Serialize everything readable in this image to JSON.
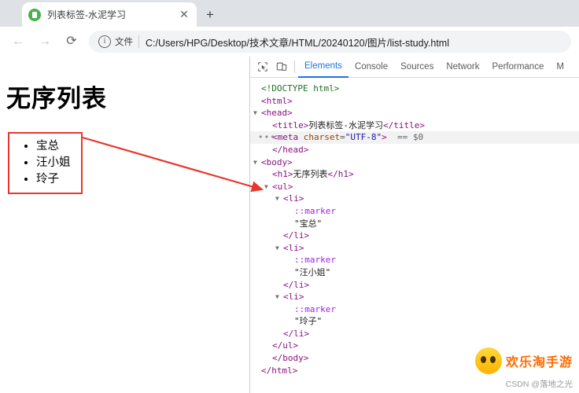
{
  "browser": {
    "tab": {
      "title": "列表标签-水泥学习",
      "favicon": "page-icon",
      "close": "✕"
    },
    "new_tab_label": "+",
    "nav": {
      "back": "←",
      "forward": "→",
      "reload": "⟳"
    },
    "omnibox": {
      "info_icon": "i",
      "scheme_label": "文件",
      "url": "C:/Users/HPG/Desktop/技术文章/HTML/20240120/图片/list-study.html"
    }
  },
  "page": {
    "heading": "无序列表",
    "list_items": [
      "宝总",
      "汪小姐",
      "玲子"
    ]
  },
  "devtools": {
    "toolbar": {
      "inspect_icon": "inspect-element-icon",
      "device_icon": "device-toolbar-icon"
    },
    "tabs": [
      {
        "label": "Elements",
        "active": true
      },
      {
        "label": "Console",
        "active": false
      },
      {
        "label": "Sources",
        "active": false
      },
      {
        "label": "Network",
        "active": false
      },
      {
        "label": "Performance",
        "active": false
      },
      {
        "label": "M",
        "active": false
      }
    ],
    "dom": [
      {
        "indent": 0,
        "arrow": "",
        "dots": false,
        "highlight": false,
        "parts": [
          {
            "c": "cm",
            "t": "<!DOCTYPE html>"
          }
        ]
      },
      {
        "indent": 0,
        "arrow": "",
        "dots": false,
        "highlight": false,
        "parts": [
          {
            "c": "tw",
            "t": "<html>"
          }
        ]
      },
      {
        "indent": 0,
        "arrow": "▼",
        "dots": false,
        "highlight": false,
        "parts": [
          {
            "c": "tw",
            "t": "<head>"
          }
        ]
      },
      {
        "indent": 1,
        "arrow": "",
        "dots": false,
        "highlight": false,
        "parts": [
          {
            "c": "tw",
            "t": "<title>"
          },
          {
            "c": "tx",
            "t": "列表标签-水泥学习"
          },
          {
            "c": "tw",
            "t": "</title>"
          }
        ]
      },
      {
        "indent": 1,
        "arrow": "",
        "dots": true,
        "highlight": true,
        "parts": [
          {
            "c": "tw",
            "t": "<meta "
          },
          {
            "c": "at",
            "t": "charset"
          },
          {
            "c": "eq",
            "t": "="
          },
          {
            "c": "av",
            "t": "\"UTF-8\""
          },
          {
            "c": "tw",
            "t": ">"
          },
          {
            "c": "sel",
            "t": "  == $0"
          }
        ]
      },
      {
        "indent": 1,
        "arrow": "",
        "dots": false,
        "highlight": false,
        "parts": [
          {
            "c": "tw",
            "t": "</head>"
          }
        ]
      },
      {
        "indent": 0,
        "arrow": "▼",
        "dots": false,
        "highlight": false,
        "parts": [
          {
            "c": "tw",
            "t": "<body>"
          }
        ]
      },
      {
        "indent": 1,
        "arrow": "",
        "dots": false,
        "highlight": false,
        "parts": [
          {
            "c": "tw",
            "t": "<h1>"
          },
          {
            "c": "tx",
            "t": "无序列表"
          },
          {
            "c": "tw",
            "t": "</h1>"
          }
        ]
      },
      {
        "indent": 1,
        "arrow": "▼",
        "dots": false,
        "highlight": false,
        "parts": [
          {
            "c": "tw",
            "t": "<ul>"
          }
        ]
      },
      {
        "indent": 2,
        "arrow": "▼",
        "dots": false,
        "highlight": false,
        "parts": [
          {
            "c": "tw",
            "t": "<li>"
          }
        ]
      },
      {
        "indent": 3,
        "arrow": "",
        "dots": false,
        "highlight": false,
        "parts": [
          {
            "c": "mk",
            "t": "::marker"
          }
        ]
      },
      {
        "indent": 3,
        "arrow": "",
        "dots": false,
        "highlight": false,
        "parts": [
          {
            "c": "tx",
            "t": "\"宝总\""
          }
        ]
      },
      {
        "indent": 2,
        "arrow": "",
        "dots": false,
        "highlight": false,
        "parts": [
          {
            "c": "tw",
            "t": "</li>"
          }
        ]
      },
      {
        "indent": 2,
        "arrow": "▼",
        "dots": false,
        "highlight": false,
        "parts": [
          {
            "c": "tw",
            "t": "<li>"
          }
        ]
      },
      {
        "indent": 3,
        "arrow": "",
        "dots": false,
        "highlight": false,
        "parts": [
          {
            "c": "mk",
            "t": "::marker"
          }
        ]
      },
      {
        "indent": 3,
        "arrow": "",
        "dots": false,
        "highlight": false,
        "parts": [
          {
            "c": "tx",
            "t": "\"汪小姐\""
          }
        ]
      },
      {
        "indent": 2,
        "arrow": "",
        "dots": false,
        "highlight": false,
        "parts": [
          {
            "c": "tw",
            "t": "</li>"
          }
        ]
      },
      {
        "indent": 2,
        "arrow": "▼",
        "dots": false,
        "highlight": false,
        "parts": [
          {
            "c": "tw",
            "t": "<li>"
          }
        ]
      },
      {
        "indent": 3,
        "arrow": "",
        "dots": false,
        "highlight": false,
        "parts": [
          {
            "c": "mk",
            "t": "::marker"
          }
        ]
      },
      {
        "indent": 3,
        "arrow": "",
        "dots": false,
        "highlight": false,
        "parts": [
          {
            "c": "tx",
            "t": "\"玲子\""
          }
        ]
      },
      {
        "indent": 2,
        "arrow": "",
        "dots": false,
        "highlight": false,
        "parts": [
          {
            "c": "tw",
            "t": "</li>"
          }
        ]
      },
      {
        "indent": 1,
        "arrow": "",
        "dots": false,
        "highlight": false,
        "parts": [
          {
            "c": "tw",
            "t": "</ul>"
          }
        ]
      },
      {
        "indent": 1,
        "arrow": "",
        "dots": false,
        "highlight": false,
        "parts": [
          {
            "c": "tw",
            "t": "</body>"
          }
        ]
      },
      {
        "indent": 0,
        "arrow": "",
        "dots": false,
        "highlight": false,
        "parts": [
          {
            "c": "tw",
            "t": "</html>"
          }
        ]
      }
    ]
  },
  "annotations": {
    "arrow_color": "#e8372c"
  },
  "watermarks": {
    "brand": "欢乐淘手游",
    "credit": "CSDN @落地之光"
  }
}
